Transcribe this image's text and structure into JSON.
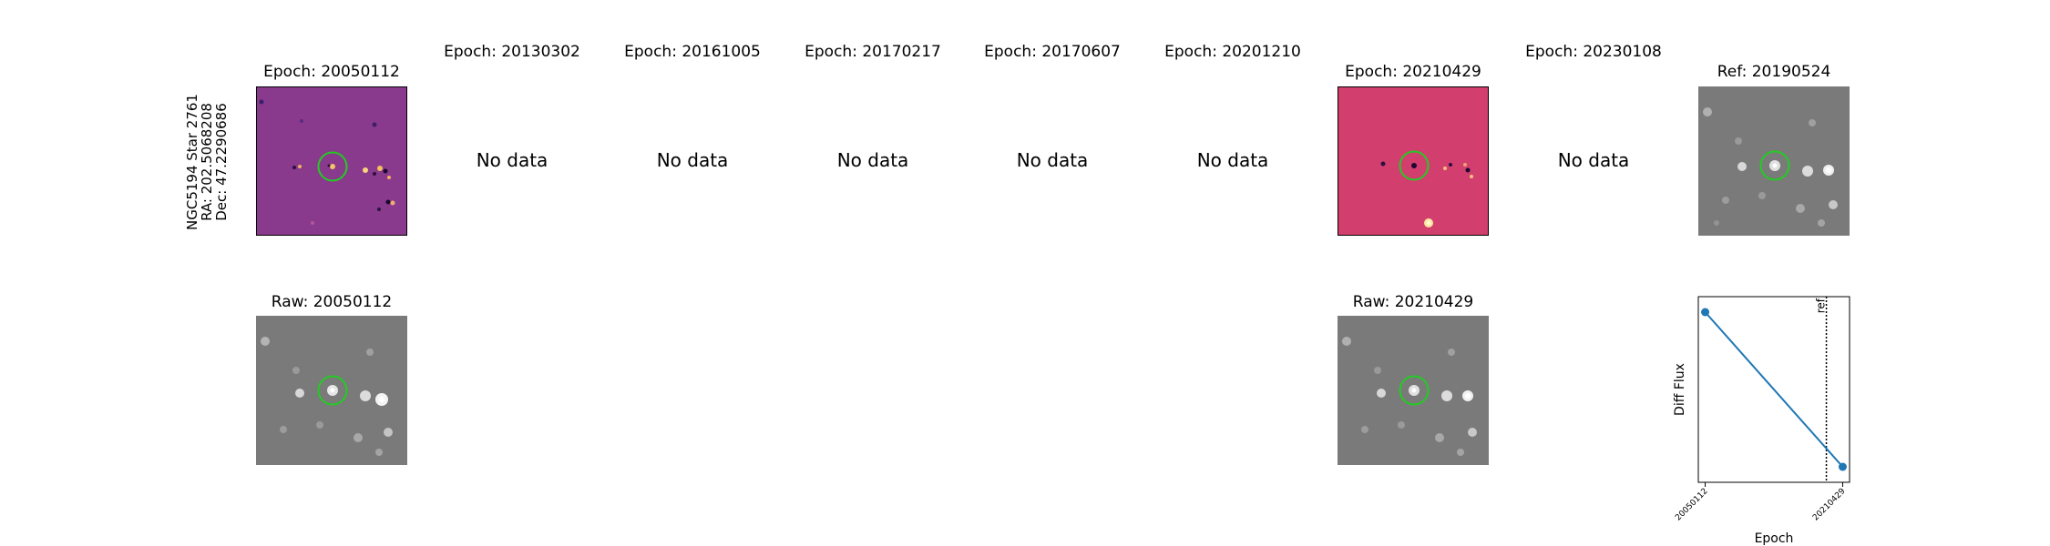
{
  "object_label": {
    "name": "NGC5194 Star 2761",
    "ra": "RA: 202.5068208",
    "dec": "Dec: 47.2290686"
  },
  "diff_titles": [
    "Epoch: 20050112",
    "Epoch: 20130302",
    "Epoch: 20161005",
    "Epoch: 20170217",
    "Epoch: 20170607",
    "Epoch: 20201210",
    "Epoch: 20210429",
    "Epoch: 20230108"
  ],
  "ref_title": "Ref: 20190524",
  "raw_titles": [
    "Raw: 20050112",
    "Raw: 20210429"
  ],
  "no_data_text": "No data",
  "colors": {
    "diff_background_1": "#8a3a8c",
    "diff_background_2": "#d23f6e",
    "grey_background": "#7a7a7a",
    "circle": "#22cc22",
    "line": "#1f77b4"
  },
  "chart_data": {
    "type": "line",
    "xlabel": "Epoch",
    "ylabel": "Diff Flux",
    "x": [
      "20050112",
      "20210429"
    ],
    "series": [
      {
        "values": [
          1.0,
          0.0
        ]
      }
    ],
    "ylim": [
      -0.1,
      1.1
    ],
    "reference_line": {
      "x": "20190524",
      "label": "ref",
      "style": "dotted"
    },
    "grid": false
  }
}
